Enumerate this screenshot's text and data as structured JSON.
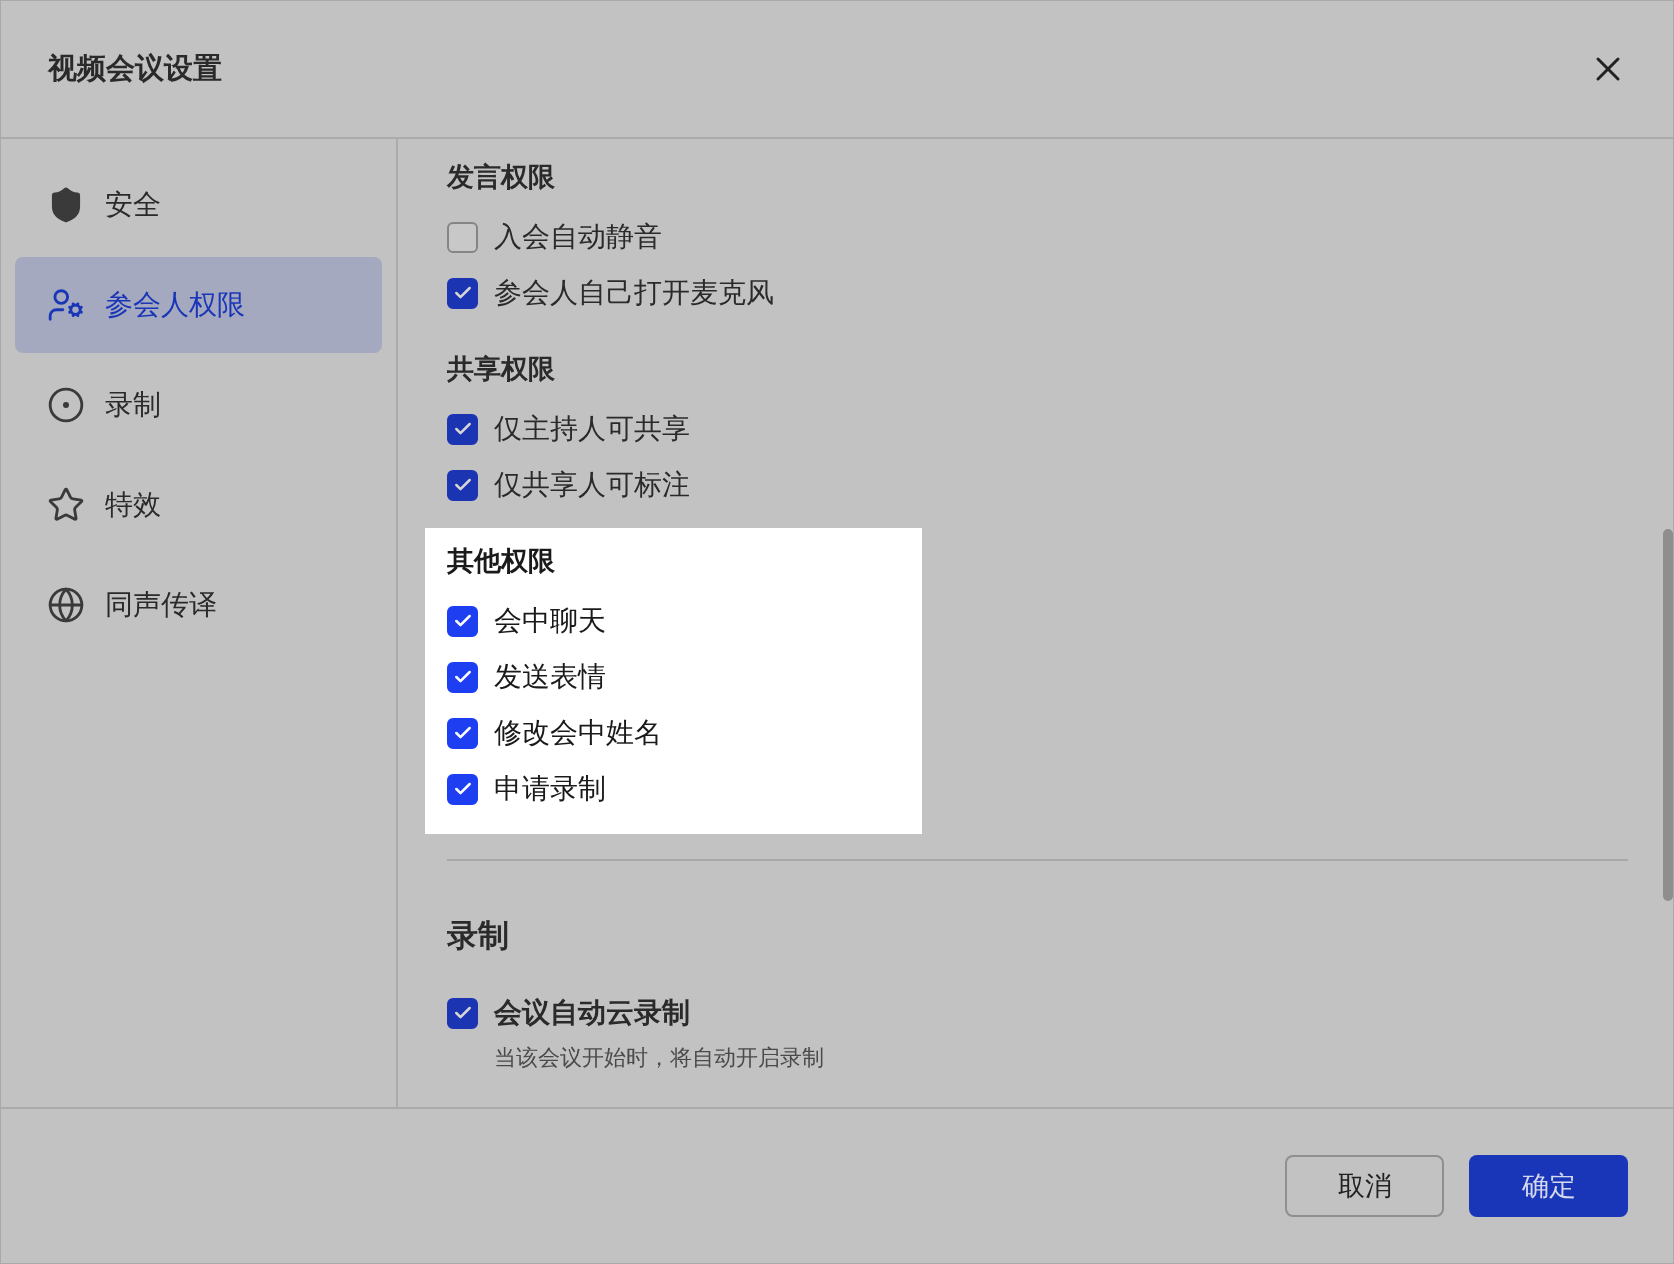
{
  "dialog": {
    "title": "视频会议设置"
  },
  "sidebar": {
    "items": [
      {
        "label": "安全",
        "selected": false
      },
      {
        "label": "参会人权限",
        "selected": true
      },
      {
        "label": "录制",
        "selected": false
      },
      {
        "label": "特效",
        "selected": false
      },
      {
        "label": "同声传译",
        "selected": false
      }
    ]
  },
  "permission_groups": [
    {
      "title": "发言权限",
      "highlighted": false,
      "options": [
        {
          "label": "入会自动静音",
          "checked": false
        },
        {
          "label": "参会人自己打开麦克风",
          "checked": true
        }
      ]
    },
    {
      "title": "共享权限",
      "highlighted": false,
      "options": [
        {
          "label": "仅主持人可共享",
          "checked": true
        },
        {
          "label": "仅共享人可标注",
          "checked": true
        }
      ]
    },
    {
      "title": "其他权限",
      "highlighted": true,
      "options": [
        {
          "label": "会中聊天",
          "checked": true
        },
        {
          "label": "发送表情",
          "checked": true
        },
        {
          "label": "修改会中姓名",
          "checked": true
        },
        {
          "label": "申请录制",
          "checked": true
        }
      ]
    }
  ],
  "recording": {
    "title": "录制",
    "option": {
      "label": "会议自动云录制",
      "checked": true,
      "description": "当该会议开始时，将自动开启录制"
    }
  },
  "buttons": [
    {
      "label": "取消",
      "kind": "secondary"
    },
    {
      "label": "确定",
      "kind": "primary"
    }
  ]
}
